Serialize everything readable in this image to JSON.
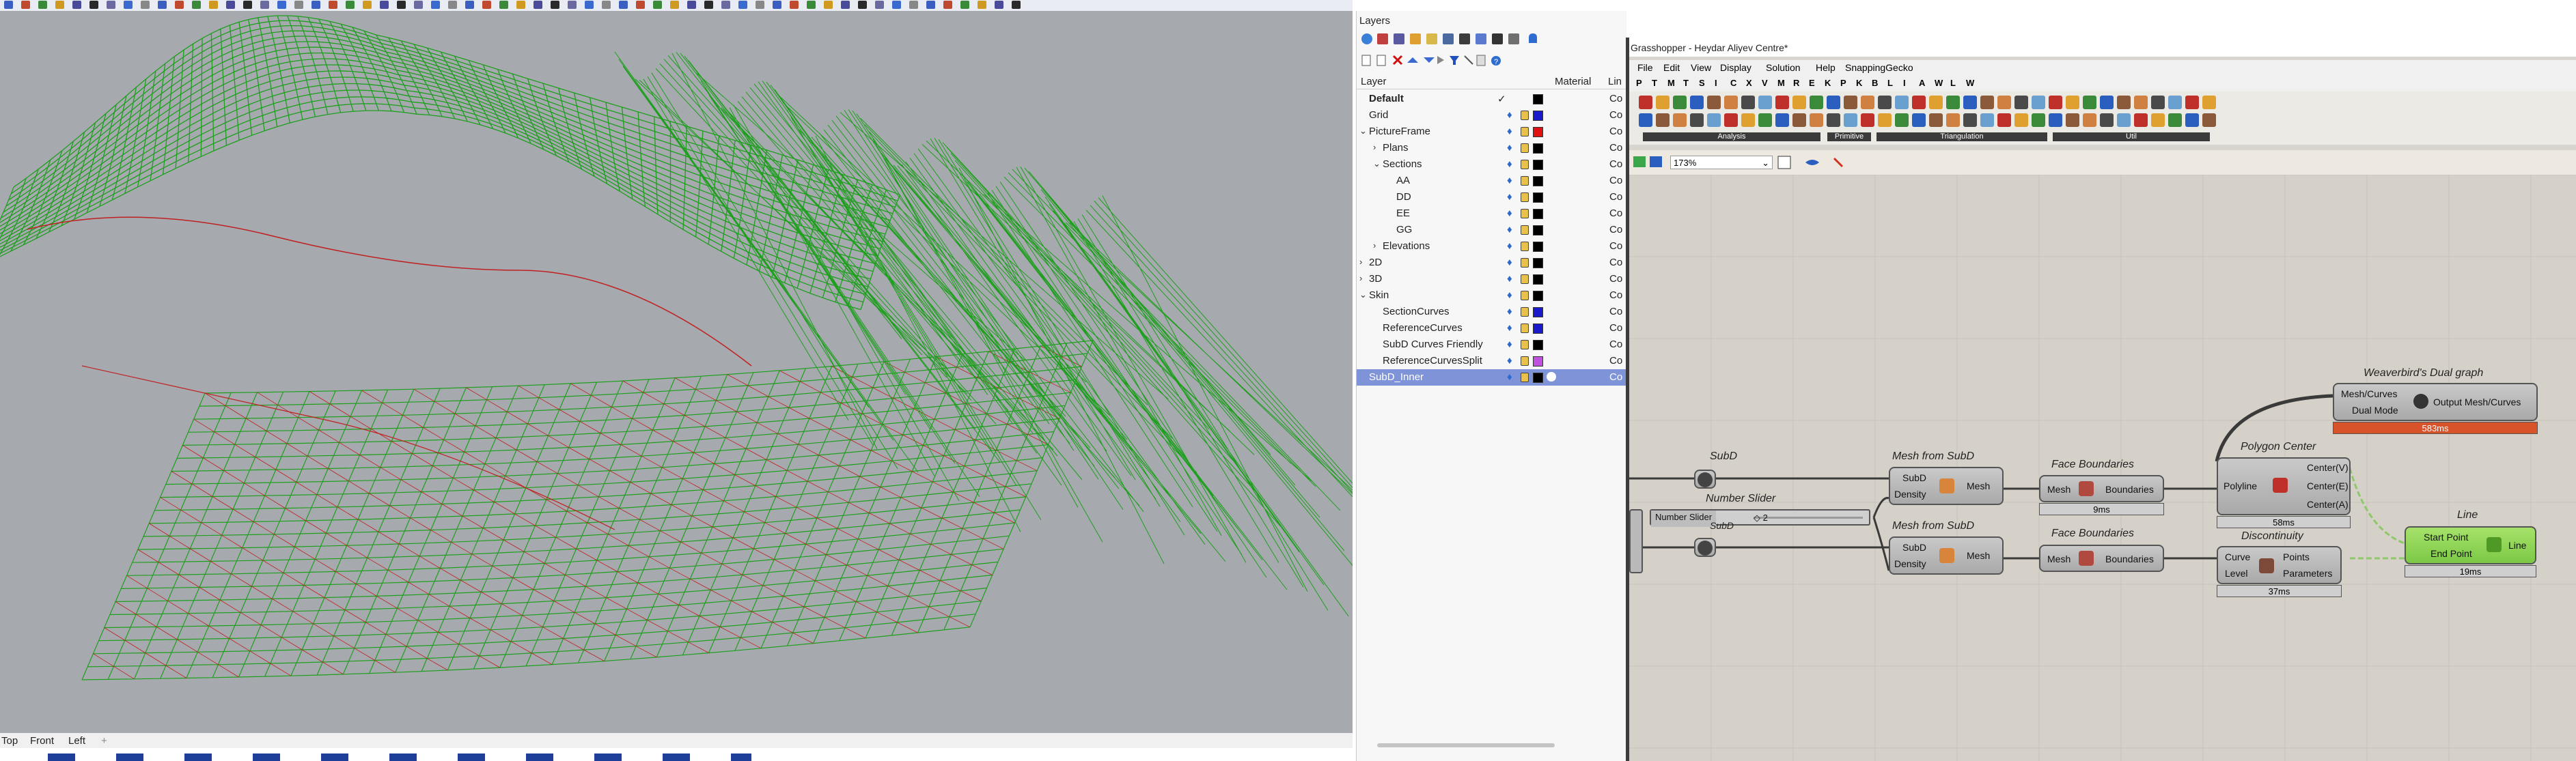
{
  "viewport": {
    "tabs": [
      "Top",
      "Front",
      "Left"
    ],
    "add_tab": "+",
    "mesh_color": "#1e9f1e",
    "edge_color": "#c02020",
    "background": "#a6a9ae"
  },
  "layers": {
    "title": "Layers",
    "header": {
      "layer": "Layer",
      "material": "Material",
      "linetype": "Lin"
    },
    "items": [
      {
        "name": "Default",
        "color": "#000000",
        "level": 0,
        "current": true,
        "bold": true
      },
      {
        "name": "Grid",
        "color": "#1a1acc",
        "level": 0
      },
      {
        "name": "PictureFrame",
        "color": "#e01010",
        "level": 0,
        "expanded": true
      },
      {
        "name": "Plans",
        "color": "#000000",
        "level": 1,
        "collapsed": true
      },
      {
        "name": "Sections",
        "color": "#000000",
        "level": 1,
        "expanded": true
      },
      {
        "name": "AA",
        "color": "#000000",
        "level": 2
      },
      {
        "name": "DD",
        "color": "#000000",
        "level": 2
      },
      {
        "name": "EE",
        "color": "#000000",
        "level": 2
      },
      {
        "name": "GG",
        "color": "#000000",
        "level": 2
      },
      {
        "name": "Elevations",
        "color": "#000000",
        "level": 1,
        "collapsed": true
      },
      {
        "name": "2D",
        "color": "#000000",
        "level": 0,
        "collapsed": true
      },
      {
        "name": "3D",
        "color": "#000000",
        "level": 0,
        "collapsed": true
      },
      {
        "name": "Skin",
        "color": "#000000",
        "level": 0,
        "expanded": true
      },
      {
        "name": "SectionCurves",
        "color": "#1a1acc",
        "level": 1
      },
      {
        "name": "ReferenceCurves",
        "color": "#1a1acc",
        "level": 1
      },
      {
        "name": "SubD Curves Friendly",
        "color": "#000000",
        "level": 1
      },
      {
        "name": "ReferenceCurvesSplit",
        "color": "#c050e0",
        "level": 1
      },
      {
        "name": "SubD_Inner",
        "color": "#000000",
        "level": 0,
        "selected": true
      }
    ],
    "linetype_abbrev": "Co"
  },
  "grasshopper": {
    "title": "Grasshopper - Heydar Aliyev Centre*",
    "menu": [
      "File",
      "Edit",
      "View",
      "Display",
      "Solution",
      "Help",
      "SnappingGecko"
    ],
    "tabs": [
      "P",
      "T",
      "M",
      "T",
      "S",
      "I",
      "C",
      "X",
      "V",
      "M",
      "R",
      "E",
      "K",
      "P",
      "K",
      "B",
      "L",
      "I",
      "A",
      "W",
      "L",
      "W"
    ],
    "ribbon_groups": [
      "Analysis",
      "Primitive",
      "Triangulation",
      "Util"
    ],
    "zoom": "173%",
    "components": {
      "subd_1": {
        "title": "SubD"
      },
      "slider": {
        "title": "Number Slider",
        "label": "Number Slider",
        "value": "◇ 2"
      },
      "subd_2": {
        "title": "SubD"
      },
      "mesh_from_subd_1": {
        "title": "Mesh from SubD",
        "in": [
          "SubD",
          "Density"
        ],
        "out": "Mesh"
      },
      "mesh_from_subd_2": {
        "title": "Mesh from SubD",
        "in": [
          "SubD",
          "Density"
        ],
        "out": "Mesh"
      },
      "face_boundaries_1": {
        "title": "Face Boundaries",
        "in": "Mesh",
        "out": "Boundaries",
        "time": "9ms"
      },
      "face_boundaries_2": {
        "title": "Face Boundaries",
        "in": "Mesh",
        "out": "Boundaries"
      },
      "polygon_center": {
        "title": "Polygon Center",
        "in": "Polyline",
        "out": [
          "Center(V)",
          "Center(E)",
          "Center(A)"
        ],
        "time": "58ms"
      },
      "discontinuity": {
        "title": "Discontinuity",
        "in": [
          "Curve",
          "Level"
        ],
        "out": [
          "Points",
          "Parameters"
        ],
        "time": "37ms"
      },
      "dual_graph": {
        "title": "Weaverbird's Dual graph",
        "in": [
          "Mesh/Curves",
          "Dual Mode"
        ],
        "out": "Output Mesh/Curves",
        "time": "583ms"
      },
      "line": {
        "title": "Line",
        "in": [
          "Start Point",
          "End Point"
        ],
        "out": "Line",
        "time": "19ms"
      }
    }
  }
}
